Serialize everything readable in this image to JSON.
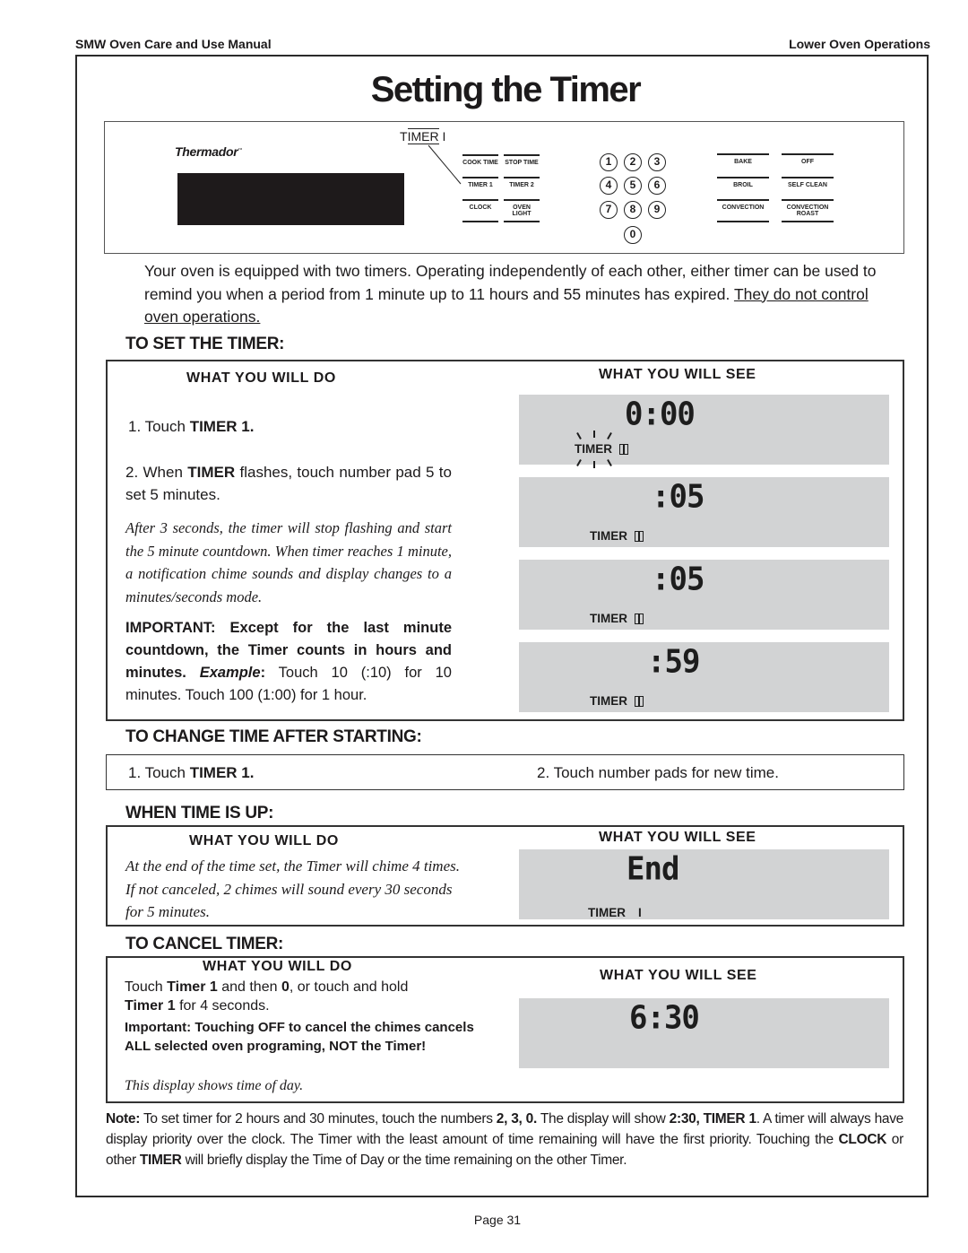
{
  "header": {
    "left": "SMW Oven Care and Use Manual",
    "right": "Lower Oven Operations"
  },
  "title": "Setting the Timer",
  "control_panel": {
    "brand": "Thermador",
    "callout": {
      "prefix": "T",
      "middle": "IMER",
      "suffix": " I"
    },
    "function_keys": [
      {
        "id": "cook-time",
        "label": "COOK TIME"
      },
      {
        "id": "stop-time",
        "label": "STOP TIME"
      },
      {
        "id": "timer-1",
        "label": "TIMER 1"
      },
      {
        "id": "timer-2",
        "label": "TIMER 2"
      },
      {
        "id": "clock",
        "label": "CLOCK"
      },
      {
        "id": "oven-light",
        "label": "OVEN LIGHT"
      }
    ],
    "number_keys": [
      "1",
      "2",
      "3",
      "4",
      "5",
      "6",
      "7",
      "8",
      "9",
      "0"
    ],
    "mode_keys": [
      {
        "id": "bake",
        "label": "BAKE"
      },
      {
        "id": "off",
        "label": "OFF"
      },
      {
        "id": "broil",
        "label": "BROIL"
      },
      {
        "id": "self-clean",
        "label": "SELF CLEAN"
      },
      {
        "id": "convection",
        "label": "CONVECTION"
      },
      {
        "id": "convection-roast",
        "label": "CONVECTION ROAST"
      }
    ]
  },
  "intro": {
    "text": "Your oven is equipped with two timers.  Operating independently of each other, either timer can be used to remind you when a period from 1 minute up to 11 hours and 55 minutes has expired.  ",
    "underlined": "They do not control oven operations."
  },
  "set_timer": {
    "title": "TO SET  THE TIMER:",
    "do_heading": "WHAT  YOU  WILL DO",
    "see_heading": "WHAT  YOU  WILL SEE",
    "step1": {
      "prefix": "1.  Touch ",
      "bold": "TIMER 1."
    },
    "step2": {
      "prefix": "2.  When ",
      "bold": "TIMER",
      "suffix": "  flashes, touch number pad 5 to set 5 minutes."
    },
    "note": "After 3 seconds, the timer will stop flashing and start the 5 minute countdown.  When timer reaches 1 minute, a notification chime sounds and display changes to a minutes/seconds mode.",
    "important": {
      "bold1": "IMPORTANT: Except for the last minute countdown, the Timer counts in hours and minutes. ",
      "italic": "Example",
      "bold2": ":",
      "rest": " Touch 10 (:10) for 10 minutes. Touch 100 (1:00) for 1 hour."
    },
    "displays": [
      {
        "digits": "0:00",
        "label": "TIMER",
        "badge": "1",
        "flashing": true
      },
      {
        "digits": ":05",
        "label": "TIMER",
        "badge": "1",
        "flashing": false
      },
      {
        "digits": ":05",
        "label": "TIMER",
        "badge": "1",
        "flashing": false
      },
      {
        "digits": ":59",
        "label": "TIMER",
        "badge": "1",
        "flashing": false
      }
    ]
  },
  "change_time": {
    "title": "TO CHANGE TIME AFTER STARTING:",
    "step1": {
      "prefix": "1.  Touch ",
      "bold": "TIMER 1."
    },
    "step2": "2.  Touch number pads for new time."
  },
  "time_up": {
    "title": "WHEN TIME IS UP:",
    "do_heading": "WHAT  YOU  WILL DO",
    "see_heading": "WHAT  YOU  WILL SEE",
    "text": "At the end of the time set, the Timer will  chime 4 times.  If not canceled, 2 chimes will sound every 30 seconds for 5 minutes.",
    "display": {
      "digits": "End",
      "label": "TIMER",
      "badge": "I"
    }
  },
  "cancel": {
    "title": "TO CANCEL TIMER:",
    "do_heading": "WHAT  YOU  WILL DO",
    "see_heading": "WHAT  YOU  WILL SEE",
    "line1": {
      "a": "Touch ",
      "b": "Timer 1",
      "c": " and then ",
      "d": "0",
      "e": ", or touch and hold"
    },
    "line2": {
      "b": "Timer 1",
      "c": " for 4 seconds."
    },
    "important": "Important:  Touching OFF to cancel the chimes cancels  ALL selected oven programing, NOT the Timer!",
    "display_note": "This display shows time of day.",
    "display": {
      "digits": "6:30"
    }
  },
  "footnote": {
    "lead": "Note:",
    "t1": " To set timer for 2 hours and 30 minutes, touch the numbers ",
    "b1": "2, 3, 0.",
    "t2": "  The display will show ",
    "b2": "2:30,  TIMER 1",
    "t3": ".  A timer will always have display priority over the clock.  The Timer with the least amount of time remaining will have the first priority.  Touching the ",
    "b3": "CLOCK",
    "t4": " or other ",
    "b4": "TIMER",
    "t5": " will briefly display the Time of Day or the time remaining on the other Timer."
  },
  "page_number": "Page 31"
}
